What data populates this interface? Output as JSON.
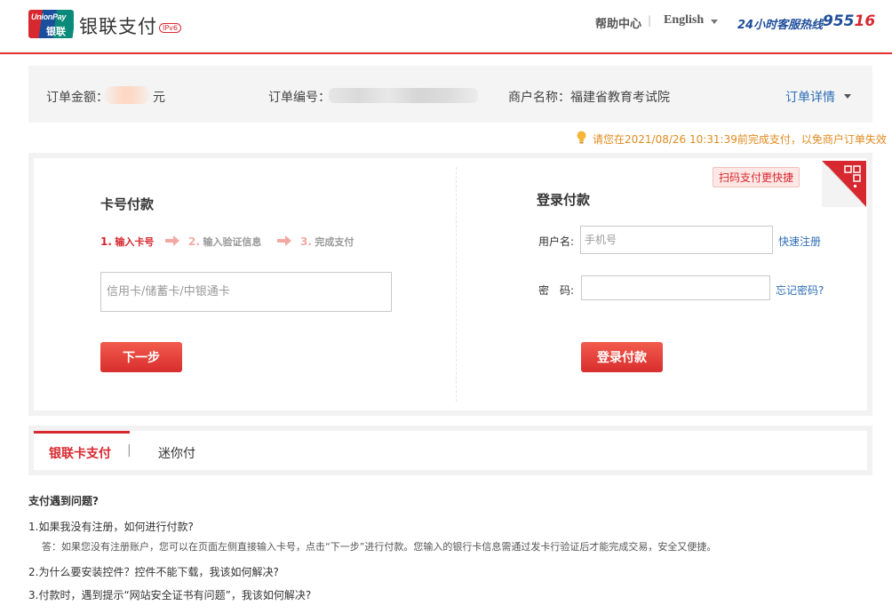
{
  "header": {
    "logo_card_text_top": "UnionPay",
    "logo_card_text_bottom": "银联",
    "logo_text": "银联支付",
    "ipv6_badge": "IPv6",
    "help_center": "帮助中心",
    "separator": "|",
    "language": "English",
    "hotline_label": "24小时客服热线",
    "hotline_number_part1": "955",
    "hotline_number_part2": "16"
  },
  "order": {
    "amount_label": "订单金额：",
    "amount_unit": "元",
    "order_no_label": "订单编号：",
    "merchant_label": "商户名称：",
    "merchant_name": "福建省教育考试院",
    "detail_link": "订单详情"
  },
  "notice": "请您在2021/08/26 10:31:39前完成支付，以免商户订单失效",
  "card_pay": {
    "title": "卡号付款",
    "steps": [
      {
        "num": "1.",
        "label": "输入卡号"
      },
      {
        "num": "2.",
        "label": "输入验证信息"
      },
      {
        "num": "3.",
        "label": "完成支付"
      }
    ],
    "card_placeholder": "信用卡/储蓄卡/中银通卡",
    "next_button": "下一步"
  },
  "login_pay": {
    "title": "登录付款",
    "username_label": "用户名:",
    "username_placeholder": "手机号",
    "register_link": "快速注册",
    "password_label": "密　码:",
    "forgot_link": "忘记密码?",
    "login_button": "登录付款",
    "qr_tag": "扫码支付更快捷"
  },
  "tabs": {
    "active": "银联卡支付",
    "separator": "|",
    "other": "迷你付"
  },
  "faq": {
    "title": "支付遇到问题?",
    "q1": "1.如果我没有注册，如何进行付款?",
    "a1": "答：如果您没有注册账户，您可以在页面左侧直接输入卡号，点击“下一步”进行付款。您输入的银行卡信息需通过发卡行验证后才能完成交易，安全又便捷。",
    "q2": "2.为什么要安装控件？控件不能下载，我该如何解决?",
    "q3": "3.付款时，遇到提示“网站安全证书有问题”，我该如何解决?"
  },
  "colors": {
    "brand_red": "#d7282f",
    "link_blue": "#2d6db5",
    "notice_orange": "#e08a1e",
    "hotline_blue": "#1f4e9a"
  }
}
